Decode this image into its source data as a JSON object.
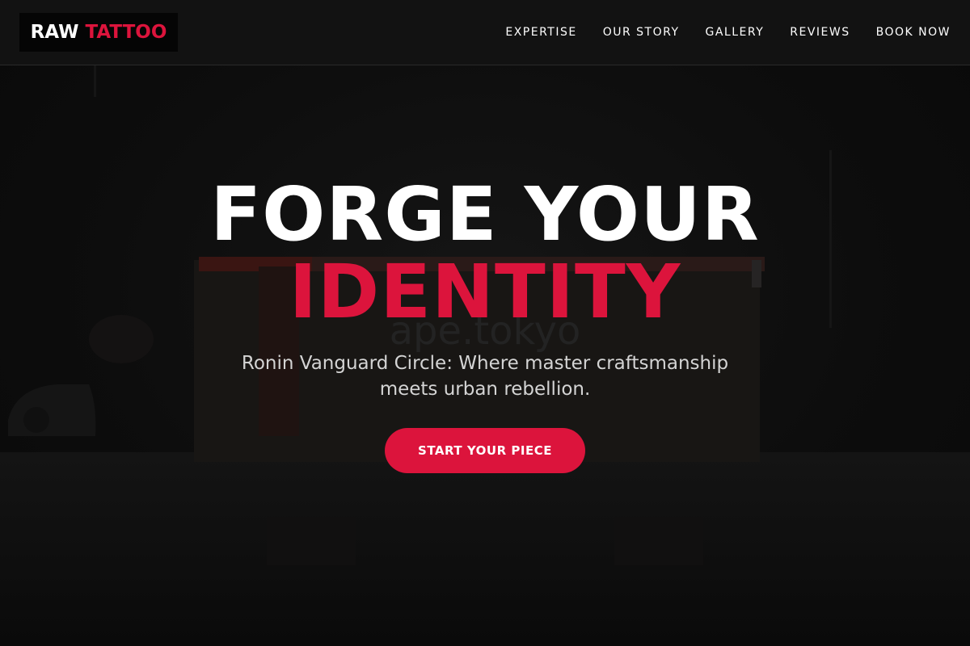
{
  "header": {
    "logo": {
      "word_a": "RAW",
      "word_b": "TATTOO"
    },
    "nav": [
      {
        "label": "EXPERTISE"
      },
      {
        "label": "OUR STORY"
      },
      {
        "label": "GALLERY"
      },
      {
        "label": "REVIEWS"
      },
      {
        "label": "BOOK NOW"
      }
    ]
  },
  "hero": {
    "title_line_1": "FORGE YOUR",
    "title_line_2": "IDENTITY",
    "subtitle": "Ronin Vanguard Circle: Where master craftsmanship meets urban rebellion.",
    "cta_label": "START YOUR PIECE",
    "background_sign_text": "ape.tokyo"
  },
  "colors": {
    "accent": "#dc143c",
    "background": "#0b0b0b",
    "header_bg": "#121212",
    "text": "#ffffff",
    "subtitle_text": "#d4d4d4"
  }
}
